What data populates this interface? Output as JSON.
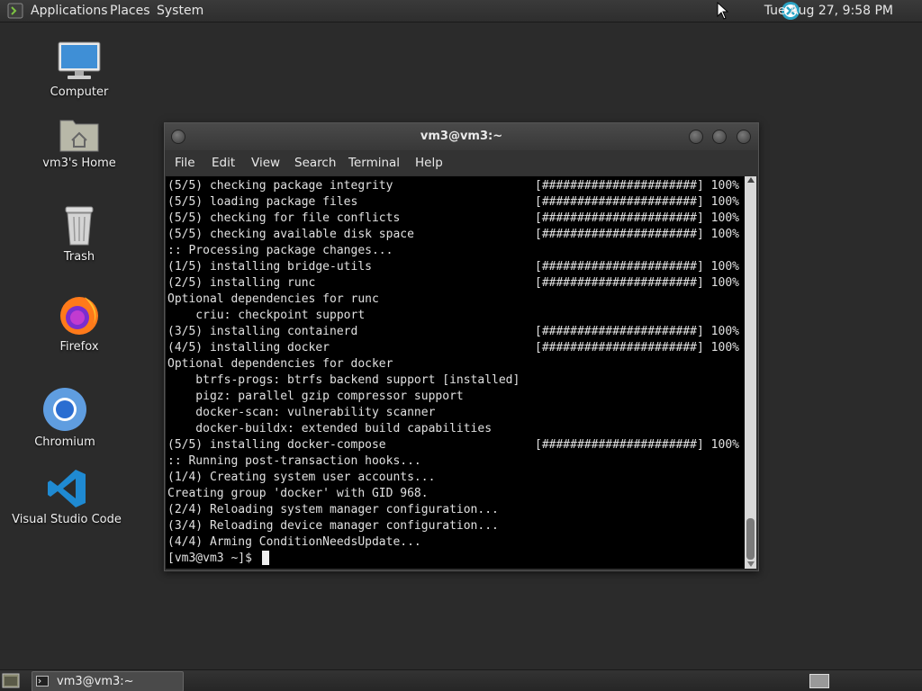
{
  "top_panel": {
    "menus": [
      "Applications",
      "Places",
      "System"
    ],
    "clock": "Tue Aug 27,  9:58 PM",
    "icons": {
      "logo": "terminal-app-icon",
      "network": "network-status-icon",
      "cursor": "mouse-cursor"
    }
  },
  "desktop": {
    "icons": [
      {
        "label": "Computer",
        "icon": "computer-icon"
      },
      {
        "label": "vm3's Home",
        "icon": "home-folder-icon"
      },
      {
        "label": "Trash",
        "icon": "trash-icon"
      },
      {
        "label": "Firefox",
        "icon": "firefox-icon"
      },
      {
        "label": "Chromium",
        "icon": "chromium-icon"
      },
      {
        "label": "Visual Studio Code",
        "icon": "vscode-icon"
      }
    ]
  },
  "window": {
    "title": "vm3@vm3:~",
    "menus": [
      "File",
      "Edit",
      "View",
      "Search",
      "Terminal",
      "Help"
    ],
    "terminal_lines": [
      {
        "text": "(5/5) checking package integrity",
        "progress": "[######################] 100%"
      },
      {
        "text": "(5/5) loading package files",
        "progress": "[######################] 100%"
      },
      {
        "text": "(5/5) checking for file conflicts",
        "progress": "[######################] 100%"
      },
      {
        "text": "(5/5) checking available disk space",
        "progress": "[######################] 100%"
      },
      {
        "text": ":: Processing package changes...",
        "progress": ""
      },
      {
        "text": "(1/5) installing bridge-utils",
        "progress": "[######################] 100%"
      },
      {
        "text": "(2/5) installing runc",
        "progress": "[######################] 100%"
      },
      {
        "text": "Optional dependencies for runc",
        "progress": ""
      },
      {
        "text": "    criu: checkpoint support",
        "progress": ""
      },
      {
        "text": "(3/5) installing containerd",
        "progress": "[######################] 100%"
      },
      {
        "text": "(4/5) installing docker",
        "progress": "[######################] 100%"
      },
      {
        "text": "Optional dependencies for docker",
        "progress": ""
      },
      {
        "text": "    btrfs-progs: btrfs backend support [installed]",
        "progress": ""
      },
      {
        "text": "    pigz: parallel gzip compressor support",
        "progress": ""
      },
      {
        "text": "    docker-scan: vulnerability scanner",
        "progress": ""
      },
      {
        "text": "    docker-buildx: extended build capabilities",
        "progress": ""
      },
      {
        "text": "(5/5) installing docker-compose",
        "progress": "[######################] 100%"
      },
      {
        "text": ":: Running post-transaction hooks...",
        "progress": ""
      },
      {
        "text": "(1/4) Creating system user accounts...",
        "progress": ""
      },
      {
        "text": "Creating group 'docker' with GID 968.",
        "progress": ""
      },
      {
        "text": "(2/4) Reloading system manager configuration...",
        "progress": ""
      },
      {
        "text": "(3/4) Reloading device manager configuration...",
        "progress": ""
      },
      {
        "text": "(4/4) Arming ConditionNeedsUpdate...",
        "progress": ""
      }
    ],
    "prompt": "[vm3@vm3 ~]$ "
  },
  "bottom_panel": {
    "task_label": "vm3@vm3:~"
  }
}
